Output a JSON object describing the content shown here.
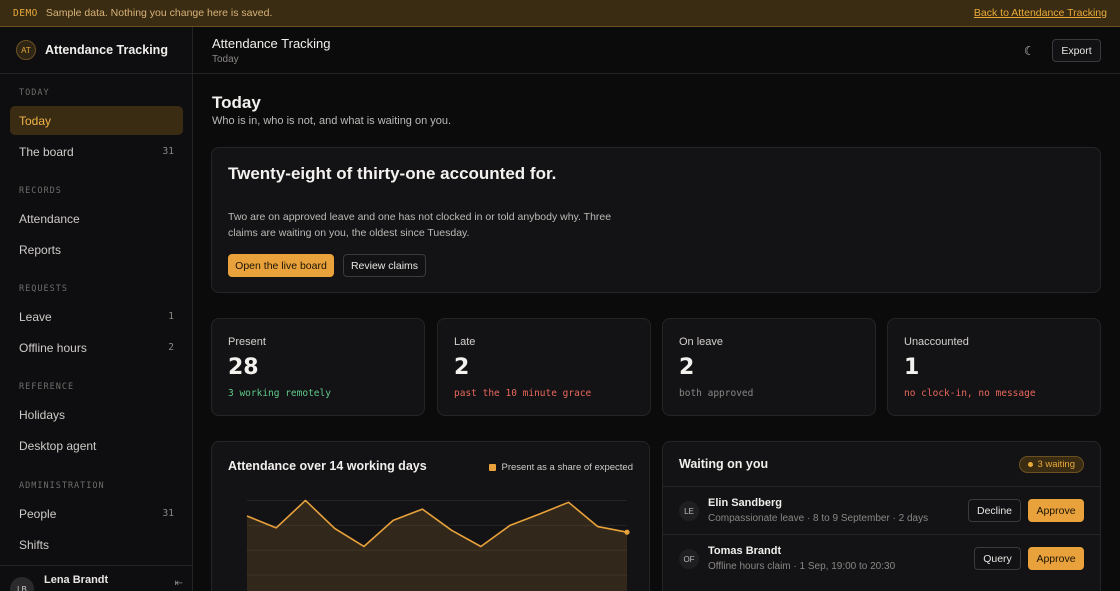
{
  "banner": {
    "tag": "DEMO",
    "message": "Sample data. Nothing you change here is saved.",
    "back_link": "Back to Attendance Tracking"
  },
  "sidebar": {
    "brand_initials": "AT",
    "brand_name": "Attendance Tracking",
    "sections": [
      {
        "label": "TODAY",
        "items": [
          {
            "label": "Today",
            "count": "",
            "active": true
          },
          {
            "label": "The board",
            "count": "31"
          }
        ]
      },
      {
        "label": "RECORDS",
        "items": [
          {
            "label": "Attendance",
            "count": ""
          },
          {
            "label": "Reports",
            "count": ""
          }
        ]
      },
      {
        "label": "REQUESTS",
        "items": [
          {
            "label": "Leave",
            "count": "1"
          },
          {
            "label": "Offline hours",
            "count": "2"
          }
        ]
      },
      {
        "label": "REFERENCE",
        "items": [
          {
            "label": "Holidays",
            "count": ""
          },
          {
            "label": "Desktop agent",
            "count": ""
          }
        ]
      },
      {
        "label": "ADMINISTRATION",
        "items": [
          {
            "label": "People",
            "count": "31"
          },
          {
            "label": "Shifts",
            "count": ""
          }
        ]
      }
    ],
    "user": {
      "initials": "LB",
      "name": "Lena Brandt",
      "logout_icon": "logout-icon",
      "logout_glyph": "⇤"
    }
  },
  "topbar": {
    "title": "Attendance Tracking",
    "subtitle": "Today",
    "theme_icon": "moon-icon",
    "theme_glyph": "☾",
    "export_label": "Export"
  },
  "page": {
    "title": "Today",
    "subtitle": "Who is in, who is not, and what is waiting on you."
  },
  "hero": {
    "headline": "Twenty-eight of thirty-one accounted for.",
    "body": "Two are on approved leave and one has not clocked in or told anybody why. Three claims are waiting on you, the oldest since Tuesday.",
    "primary_label": "Open the live board",
    "secondary_label": "Review claims"
  },
  "stats": [
    {
      "label": "Present",
      "value": "28",
      "note": "3 working remotely",
      "tone": "green"
    },
    {
      "label": "Late",
      "value": "2",
      "note": "past the 10 minute grace",
      "tone": "red"
    },
    {
      "label": "On leave",
      "value": "2",
      "note": "both approved",
      "tone": "grey"
    },
    {
      "label": "Unaccounted",
      "value": "1",
      "note": "no clock-in, no message",
      "tone": "red"
    }
  ],
  "chart_data": {
    "type": "area",
    "title": "Attendance over 14 working days",
    "series": [
      {
        "name": "Present as a share of expected",
        "values": [
          0.855,
          0.836,
          0.88,
          0.835,
          0.806,
          0.848,
          0.866,
          0.832,
          0.806,
          0.84,
          0.858,
          0.877,
          0.838,
          0.829
        ]
      }
    ],
    "ylim": [
      0.72,
      0.9
    ],
    "grid": true,
    "legend_position": "top-right",
    "color": "#e9a23b"
  },
  "waiting": {
    "title": "Waiting on you",
    "badge": "3 waiting",
    "rows": [
      {
        "initials": "LE",
        "name": "Elin Sandberg",
        "detail": "Compassionate leave · 8 to 9 September · 2 days",
        "secondary": "Decline",
        "primary": "Approve"
      },
      {
        "initials": "OF",
        "name": "Tomas Brandt",
        "detail": "Offline hours claim · 1 Sep, 19:00 to 20:30",
        "secondary": "Query",
        "primary": "Approve"
      }
    ]
  }
}
